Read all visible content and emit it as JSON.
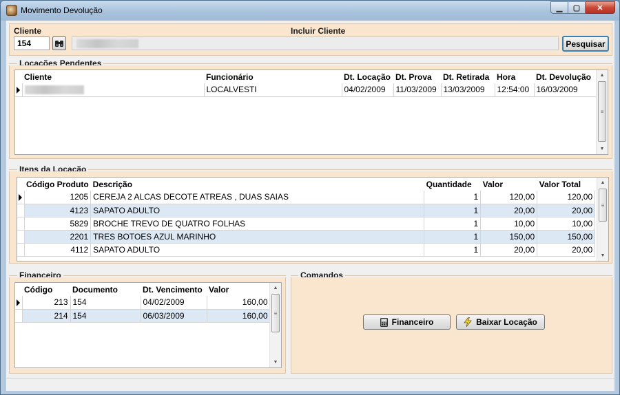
{
  "window": {
    "title": "Movimento Devolução",
    "minimize_glyph": "▁",
    "maximize_glyph": "▢",
    "close_glyph": "✕"
  },
  "cliente_panel": {
    "cliente_label": "Cliente",
    "cliente_code": "154",
    "search_icon": "binoculars-icon",
    "incluir_label": "Incluir Cliente",
    "pesquisar_label": "Pesquisar"
  },
  "locacoes": {
    "title": "Locações Pendentes",
    "columns": [
      "Cliente",
      "Funcionário",
      "Dt. Locação",
      "Dt. Prova",
      "Dt. Retirada",
      "Hora",
      "Dt. Devolução"
    ],
    "rows": [
      {
        "cliente": "",
        "funcionario": "LOCALVESTI",
        "dt_locacao": "04/02/2009",
        "dt_prova": "11/03/2009",
        "dt_retirada": "13/03/2009",
        "hora": "12:54:00",
        "dt_devolucao": "16/03/2009"
      }
    ]
  },
  "itens": {
    "title": "Itens da Locação",
    "columns": [
      "Código Produto",
      "Descrição",
      "Quantidade",
      "Valor",
      "Valor Total"
    ],
    "rows": [
      {
        "codigo": "1205",
        "descricao": "CEREJA 2 ALCAS DECOTE ATREAS , DUAS SAIAS",
        "quantidade": "1",
        "valor": "120,00",
        "total": "120,00"
      },
      {
        "codigo": "4123",
        "descricao": "SAPATO ADULTO",
        "quantidade": "1",
        "valor": "20,00",
        "total": "20,00"
      },
      {
        "codigo": "5829",
        "descricao": "BROCHE TREVO DE QUATRO FOLHAS",
        "quantidade": "1",
        "valor": "10,00",
        "total": "10,00"
      },
      {
        "codigo": "2201",
        "descricao": "TRES BOTOES AZUL MARINHO",
        "quantidade": "1",
        "valor": "150,00",
        "total": "150,00"
      },
      {
        "codigo": "4112",
        "descricao": "SAPATO ADULTO",
        "quantidade": "1",
        "valor": "20,00",
        "total": "20,00"
      }
    ]
  },
  "financeiro": {
    "title": "Financeiro",
    "columns": [
      "Código",
      "Documento",
      "Dt. Vencimento",
      "Valor"
    ],
    "rows": [
      {
        "codigo": "213",
        "documento": "154",
        "vencimento": "04/02/2009",
        "valor": "160,00"
      },
      {
        "codigo": "214",
        "documento": "154",
        "vencimento": "06/03/2009",
        "valor": "160,00"
      }
    ]
  },
  "comandos": {
    "title": "Comandos",
    "financeiro_button": "Financeiro",
    "financeiro_icon": "calculator-icon",
    "baixar_button": "Baixar Locação",
    "baixar_icon": "lightning-icon"
  },
  "scroll_glyphs": {
    "up": "▲",
    "down": "▼",
    "grip": "≡"
  }
}
